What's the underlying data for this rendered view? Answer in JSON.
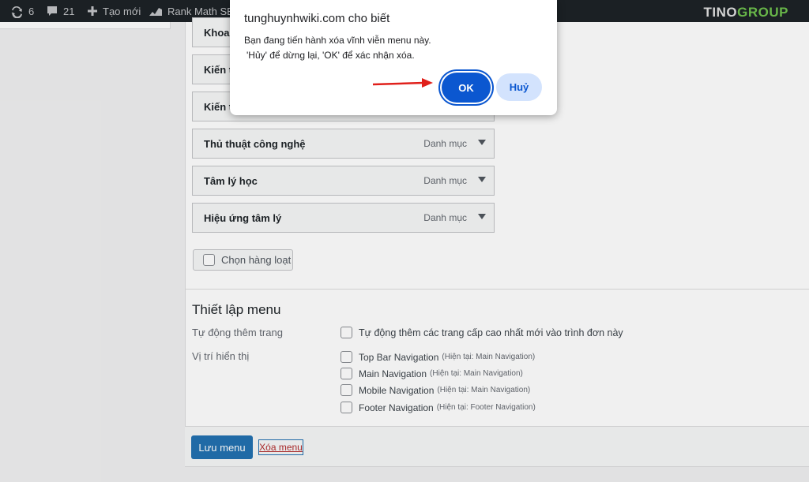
{
  "admin_bar": {
    "updates_count": "6",
    "comments_count": "21",
    "new_label": "Tạo mới",
    "rankmath_label": "Rank Math SE",
    "brand_left": "TINO",
    "brand_right": "GROUP"
  },
  "menu_items": [
    {
      "title": "Khoa",
      "type": ""
    },
    {
      "title": "Kiến t",
      "type": ""
    },
    {
      "title": "Kiến t",
      "type": ""
    },
    {
      "title": "Thủ thuật công nghệ",
      "type": "Danh mục"
    },
    {
      "title": "Tâm lý học",
      "type": "Danh mục"
    },
    {
      "title": "Hiệu ứng tâm lý",
      "type": "Danh mục"
    }
  ],
  "bulk_select_label": "Chọn hàng loạt",
  "menu_settings": {
    "title": "Thiết lập menu",
    "auto_add_label": "Tự động thêm trang",
    "auto_add_option": "Tự động thêm các trang cấp cao nhất mới vào trình đơn này",
    "display_location_label": "Vị trí hiển thị",
    "locations": [
      {
        "name": "Top Bar Navigation",
        "current": "(Hiện tại: Main Navigation)"
      },
      {
        "name": "Main Navigation",
        "current": "(Hiện tại: Main Navigation)"
      },
      {
        "name": "Mobile Navigation",
        "current": "(Hiện tại: Main Navigation)"
      },
      {
        "name": "Footer Navigation",
        "current": "(Hiện tại: Footer Navigation)"
      }
    ]
  },
  "footer": {
    "save_label": "Lưu menu",
    "delete_label": "Xóa menu"
  },
  "dialog": {
    "title": "tunghuynhwiki.com cho biết",
    "message_line1": "Bạn đang tiến hành xóa vĩnh viễn menu này.",
    "message_line2": "'Hủy' để dừng lại, 'OK' để xác nhận xóa.",
    "ok_label": "OK",
    "cancel_label": "Huỷ"
  },
  "colors": {
    "primary": "#2271b1",
    "dialog_ok": "#0b57d0",
    "dialog_cancel_bg": "#d3e3fd",
    "annotation_arrow": "#e0201b"
  }
}
